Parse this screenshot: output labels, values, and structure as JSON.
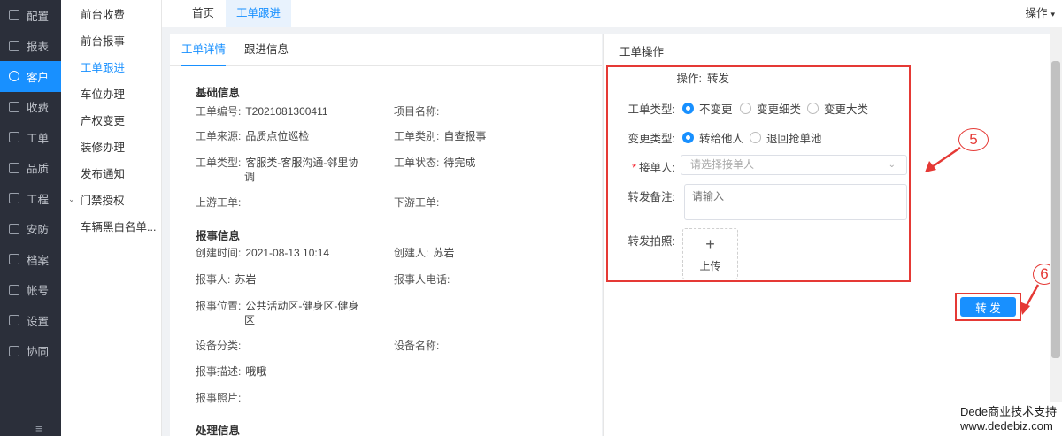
{
  "nav": {
    "items": [
      {
        "label": "配置",
        "icon": "gear-icon"
      },
      {
        "label": "报表",
        "icon": "chart-icon"
      },
      {
        "label": "客户",
        "icon": "user-icon"
      },
      {
        "label": "收费",
        "icon": "wallet-icon"
      },
      {
        "label": "工单",
        "icon": "document-icon"
      },
      {
        "label": "品质",
        "icon": "quality-icon"
      },
      {
        "label": "工程",
        "icon": "engineering-icon"
      },
      {
        "label": "安防",
        "icon": "security-icon"
      },
      {
        "label": "档案",
        "icon": "archive-icon"
      },
      {
        "label": "帐号",
        "icon": "account-icon"
      },
      {
        "label": "设置",
        "icon": "settings-icon"
      },
      {
        "label": "协同",
        "icon": "collaboration-icon"
      }
    ],
    "active": "客户"
  },
  "submenu": {
    "items": [
      {
        "label": "前台收费"
      },
      {
        "label": "前台报事"
      },
      {
        "label": "工单跟进"
      },
      {
        "label": "车位办理"
      },
      {
        "label": "产权变更"
      },
      {
        "label": "装修办理"
      },
      {
        "label": "发布通知"
      },
      {
        "label": "门禁授权"
      },
      {
        "label": "车辆黑白名单..."
      }
    ],
    "active": "工单跟进"
  },
  "tabs": [
    {
      "label": "首页"
    },
    {
      "label": "工单跟进"
    }
  ],
  "ops_label": "操作",
  "detail": {
    "subtabs": [
      {
        "label": "工单详情"
      },
      {
        "label": "跟进信息"
      }
    ],
    "basic": {
      "title": "基础信息",
      "order_no_label": "工单编号:",
      "order_no": "T2021081300411",
      "project_label": "项目名称:",
      "project": "",
      "source_label": "工单来源:",
      "source": "品质点位巡检",
      "category_label": "工单类别:",
      "category": "自查报事",
      "type_label": "工单类型:",
      "type": "客服类-客服沟通-邻里协调",
      "status_label": "工单状态:",
      "status": "待完成",
      "upstream_label": "上游工单:",
      "upstream": "",
      "downstream_label": "下游工单:",
      "downstream": ""
    },
    "report": {
      "title": "报事信息",
      "created_time_label": "创建时间:",
      "created_time": "2021-08-13 10:14",
      "creator_label": "创建人:",
      "creator": "苏岩",
      "reporter_label": "报事人:",
      "reporter": "苏岩",
      "reporter_phone_label": "报事人电话:",
      "reporter_phone": "",
      "location_label": "报事位置:",
      "location": "公共活动区-健身区-健身区",
      "device_cat_label": "设备分类:",
      "device_cat": "",
      "device_name_label": "设备名称:",
      "device_name": "",
      "desc_label": "报事描述:",
      "desc": "哦哦",
      "photo_label": "报事照片:"
    },
    "handle": {
      "title": "处理信息"
    }
  },
  "operation": {
    "title": "工单操作",
    "op_label": "操作:",
    "op_value": "转发",
    "type_label": "工单类型:",
    "type_options": [
      {
        "label": "不变更",
        "checked": true
      },
      {
        "label": "变更细类",
        "checked": false
      },
      {
        "label": "变更大类",
        "checked": false
      }
    ],
    "change_label": "变更类型:",
    "change_options": [
      {
        "label": "转给他人",
        "checked": true
      },
      {
        "label": "退回抢单池",
        "checked": false
      }
    ],
    "receiver_label": "接单人:",
    "receiver_placeholder": "请选择接单人",
    "remark_label": "转发备注:",
    "remark_placeholder": "请输入",
    "photo_label": "转发拍照:",
    "upload_label": "上传",
    "submit_label": "转 发"
  },
  "annotations": {
    "step5": "5",
    "step6": "6"
  },
  "watermark": {
    "line1": "Dede商业技术支持",
    "line2": "www.dedebiz.com"
  }
}
